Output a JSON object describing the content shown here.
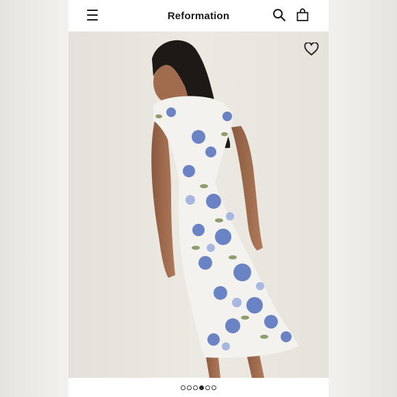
{
  "header": {
    "brand": "Reformation",
    "icons": [
      "menu-icon",
      "search-icon",
      "shopping-bag-icon"
    ]
  },
  "product_image": {
    "favorite_icon": "heart-icon",
    "description_colors": {
      "dress_base": "#f3f2ef",
      "floral_blue": "#5b78c0",
      "leaf_green": "#7d8f54",
      "background": "#e9e6e0"
    }
  },
  "carousel": {
    "total": 6,
    "active_index": 3
  },
  "colors": {
    "background": "#eeede9",
    "header_bg": "#ffffff",
    "text": "#1a1a1a"
  }
}
